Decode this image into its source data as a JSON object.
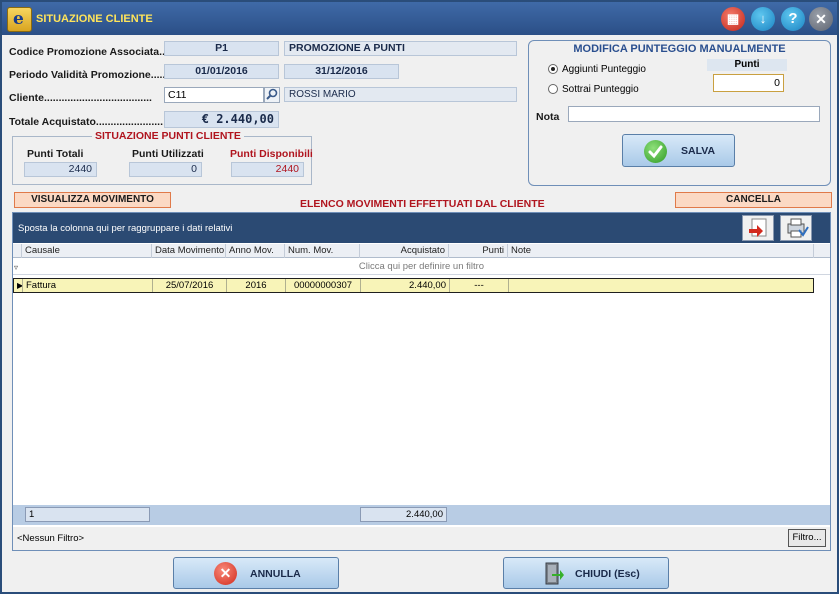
{
  "window": {
    "title": "SITUAZIONE CLIENTE",
    "app_icon_letter": "e"
  },
  "titlebar_buttons": [
    {
      "name": "calculator-icon",
      "glyph": "▦"
    },
    {
      "name": "download-icon",
      "glyph": "↓"
    },
    {
      "name": "help-icon",
      "glyph": "?"
    },
    {
      "name": "close-icon",
      "glyph": "✕"
    }
  ],
  "form": {
    "codice_label": "Codice Promozione Associata....",
    "codice_value": "P1",
    "promo_name": "PROMOZIONE A PUNTI",
    "periodo_label": "Periodo Validità Promozione........",
    "periodo_from": "01/01/2016",
    "periodo_to": "31/12/2016",
    "cliente_label": "Cliente.....................................",
    "cliente_code": "C11",
    "cliente_name": "ROSSI MARIO",
    "totale_label": "Totale Acquistato.......................",
    "totale_value": "€ 2.440,00"
  },
  "situazione": {
    "title": "SITUAZIONE PUNTI CLIENTE",
    "totali_label": "Punti Totali",
    "totali_value": "2440",
    "utilizzati_label": "Punti Utilizzati",
    "utilizzati_value": "0",
    "disponibili_label": "Punti Disponibili",
    "disponibili_value": "2440"
  },
  "modifica": {
    "title": "MODIFICA PUNTEGGIO MANUALMENTE",
    "option_add": "Aggiunti Punteggio",
    "option_sub": "Sottrai Punteggio",
    "selected": "add",
    "punti_label": "Punti",
    "punti_value": "0",
    "nota_label": "Nota",
    "nota_value": "",
    "salva_label": "SALVA"
  },
  "list": {
    "visualizza_label": "VISUALIZZA MOVIMENTO",
    "title": "ELENCO MOVIMENTI EFFETTUATI DAL CLIENTE",
    "cancella_label": "CANCELLA",
    "group_hint": "Sposta la colonna qui per raggruppare i dati relativi",
    "filter_hint": "Clicca qui per definire un filtro",
    "columns": [
      "Causale",
      "Data Movimento",
      "Anno Mov.",
      "Num. Mov.",
      "Acquistato",
      "Punti",
      "Note"
    ],
    "rows": [
      {
        "causale": "Fattura",
        "data": "25/07/2016",
        "anno": "2016",
        "num": "00000000307",
        "acquistato": "2.440,00",
        "punti": "---",
        "note": ""
      }
    ],
    "summary_count": "1",
    "summary_acquistato": "2.440,00",
    "filter_status": "<Nessun Filtro>",
    "filtro_button": "Filtro..."
  },
  "footer": {
    "annulla_label": "ANNULLA",
    "chiudi_label": "CHIUDI (Esc)"
  },
  "colors": {
    "accent_red": "#b0141e",
    "title_yellow": "#ffe45a",
    "header_blue": "#2b4a73"
  }
}
